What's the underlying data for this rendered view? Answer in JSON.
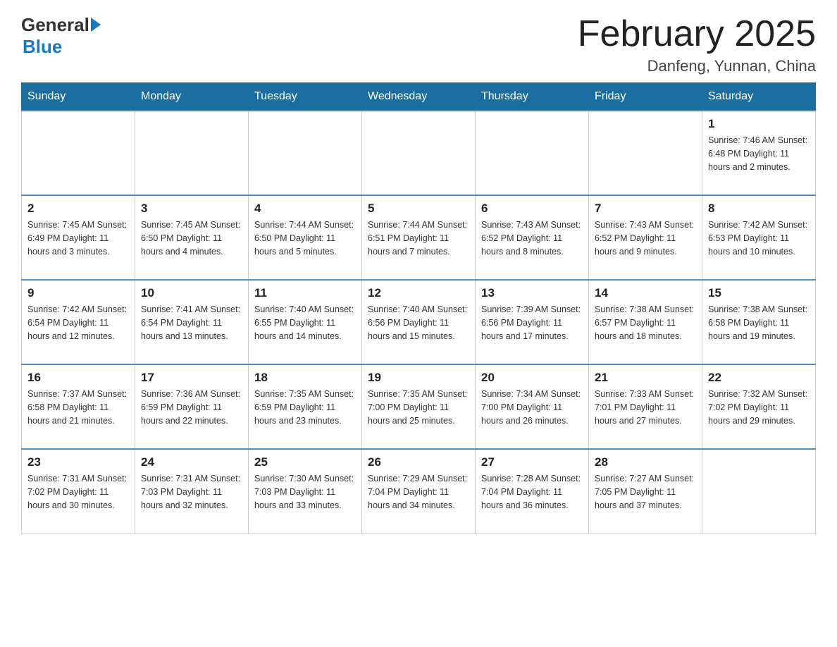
{
  "header": {
    "logo_general": "General",
    "logo_blue": "Blue",
    "month_title": "February 2025",
    "location": "Danfeng, Yunnan, China"
  },
  "days_of_week": [
    "Sunday",
    "Monday",
    "Tuesday",
    "Wednesday",
    "Thursday",
    "Friday",
    "Saturday"
  ],
  "weeks": [
    {
      "days": [
        {
          "number": "",
          "info": ""
        },
        {
          "number": "",
          "info": ""
        },
        {
          "number": "",
          "info": ""
        },
        {
          "number": "",
          "info": ""
        },
        {
          "number": "",
          "info": ""
        },
        {
          "number": "",
          "info": ""
        },
        {
          "number": "1",
          "info": "Sunrise: 7:46 AM\nSunset: 6:48 PM\nDaylight: 11 hours\nand 2 minutes."
        }
      ]
    },
    {
      "days": [
        {
          "number": "2",
          "info": "Sunrise: 7:45 AM\nSunset: 6:49 PM\nDaylight: 11 hours\nand 3 minutes."
        },
        {
          "number": "3",
          "info": "Sunrise: 7:45 AM\nSunset: 6:50 PM\nDaylight: 11 hours\nand 4 minutes."
        },
        {
          "number": "4",
          "info": "Sunrise: 7:44 AM\nSunset: 6:50 PM\nDaylight: 11 hours\nand 5 minutes."
        },
        {
          "number": "5",
          "info": "Sunrise: 7:44 AM\nSunset: 6:51 PM\nDaylight: 11 hours\nand 7 minutes."
        },
        {
          "number": "6",
          "info": "Sunrise: 7:43 AM\nSunset: 6:52 PM\nDaylight: 11 hours\nand 8 minutes."
        },
        {
          "number": "7",
          "info": "Sunrise: 7:43 AM\nSunset: 6:52 PM\nDaylight: 11 hours\nand 9 minutes."
        },
        {
          "number": "8",
          "info": "Sunrise: 7:42 AM\nSunset: 6:53 PM\nDaylight: 11 hours\nand 10 minutes."
        }
      ]
    },
    {
      "days": [
        {
          "number": "9",
          "info": "Sunrise: 7:42 AM\nSunset: 6:54 PM\nDaylight: 11 hours\nand 12 minutes."
        },
        {
          "number": "10",
          "info": "Sunrise: 7:41 AM\nSunset: 6:54 PM\nDaylight: 11 hours\nand 13 minutes."
        },
        {
          "number": "11",
          "info": "Sunrise: 7:40 AM\nSunset: 6:55 PM\nDaylight: 11 hours\nand 14 minutes."
        },
        {
          "number": "12",
          "info": "Sunrise: 7:40 AM\nSunset: 6:56 PM\nDaylight: 11 hours\nand 15 minutes."
        },
        {
          "number": "13",
          "info": "Sunrise: 7:39 AM\nSunset: 6:56 PM\nDaylight: 11 hours\nand 17 minutes."
        },
        {
          "number": "14",
          "info": "Sunrise: 7:38 AM\nSunset: 6:57 PM\nDaylight: 11 hours\nand 18 minutes."
        },
        {
          "number": "15",
          "info": "Sunrise: 7:38 AM\nSunset: 6:58 PM\nDaylight: 11 hours\nand 19 minutes."
        }
      ]
    },
    {
      "days": [
        {
          "number": "16",
          "info": "Sunrise: 7:37 AM\nSunset: 6:58 PM\nDaylight: 11 hours\nand 21 minutes."
        },
        {
          "number": "17",
          "info": "Sunrise: 7:36 AM\nSunset: 6:59 PM\nDaylight: 11 hours\nand 22 minutes."
        },
        {
          "number": "18",
          "info": "Sunrise: 7:35 AM\nSunset: 6:59 PM\nDaylight: 11 hours\nand 23 minutes."
        },
        {
          "number": "19",
          "info": "Sunrise: 7:35 AM\nSunset: 7:00 PM\nDaylight: 11 hours\nand 25 minutes."
        },
        {
          "number": "20",
          "info": "Sunrise: 7:34 AM\nSunset: 7:00 PM\nDaylight: 11 hours\nand 26 minutes."
        },
        {
          "number": "21",
          "info": "Sunrise: 7:33 AM\nSunset: 7:01 PM\nDaylight: 11 hours\nand 27 minutes."
        },
        {
          "number": "22",
          "info": "Sunrise: 7:32 AM\nSunset: 7:02 PM\nDaylight: 11 hours\nand 29 minutes."
        }
      ]
    },
    {
      "days": [
        {
          "number": "23",
          "info": "Sunrise: 7:31 AM\nSunset: 7:02 PM\nDaylight: 11 hours\nand 30 minutes."
        },
        {
          "number": "24",
          "info": "Sunrise: 7:31 AM\nSunset: 7:03 PM\nDaylight: 11 hours\nand 32 minutes."
        },
        {
          "number": "25",
          "info": "Sunrise: 7:30 AM\nSunset: 7:03 PM\nDaylight: 11 hours\nand 33 minutes."
        },
        {
          "number": "26",
          "info": "Sunrise: 7:29 AM\nSunset: 7:04 PM\nDaylight: 11 hours\nand 34 minutes."
        },
        {
          "number": "27",
          "info": "Sunrise: 7:28 AM\nSunset: 7:04 PM\nDaylight: 11 hours\nand 36 minutes."
        },
        {
          "number": "28",
          "info": "Sunrise: 7:27 AM\nSunset: 7:05 PM\nDaylight: 11 hours\nand 37 minutes."
        },
        {
          "number": "",
          "info": ""
        }
      ]
    }
  ]
}
